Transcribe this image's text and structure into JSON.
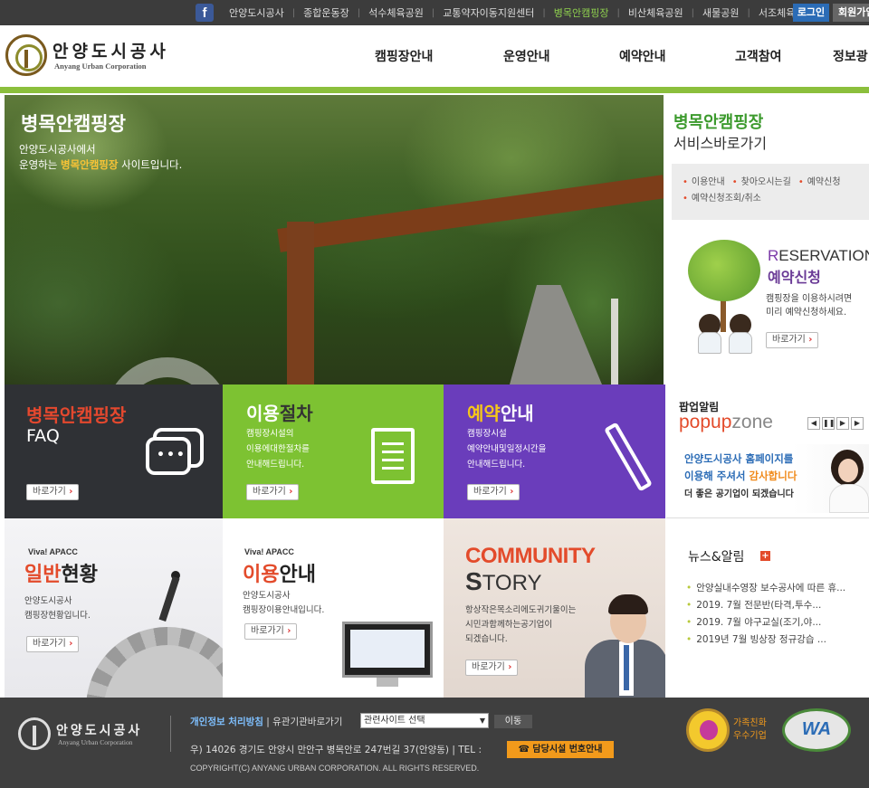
{
  "topbar": {
    "facebook": "f",
    "links": [
      "안양도시공사",
      "종합운동장",
      "석수체육공원",
      "교통약자이동지원센터",
      "병목안캠핑장",
      "비산체육공원",
      "새물공원",
      "서조체육시설"
    ],
    "active_index": 4,
    "login": "로그인",
    "join": "회원가입"
  },
  "header": {
    "logo_ko": "안양도시공사",
    "logo_en": "Anyang Urban Corporation",
    "nav": [
      "캠핑장안내",
      "운영안내",
      "예약안내",
      "고객참여",
      "정보광"
    ]
  },
  "hero": {
    "title": "병목안캠핑장",
    "desc_line1": "안양도시공사에서",
    "desc_pre": "운영하는 ",
    "desc_highlight": "병목안캠핑장",
    "desc_post": " 사이트입니다."
  },
  "service": {
    "title": "병목안캠핑장",
    "subtitle": "서비스바로가기",
    "links": [
      "이용안내",
      "찾아오시는길",
      "예약신청",
      "예약신청조회/취소"
    ],
    "res_en_first": "R",
    "res_en_rest": "ESERVATION",
    "res_ko": "예약신청",
    "res_desc1": "캠핑장을 이용하시려면",
    "res_desc2": "미리 예약신청하세요.",
    "go": "바로가기"
  },
  "tiles": {
    "faq": {
      "title": "병목안캠핑장",
      "sub": "FAQ",
      "go": "바로가기"
    },
    "procedure": {
      "title_a": "이용",
      "title_b": "절차",
      "desc1": "캠핑장시설의",
      "desc2": "이용에대한절차를",
      "desc3": "안내해드립니다.",
      "go": "바로가기"
    },
    "reservation": {
      "title_a": "예약",
      "title_b": "안내",
      "desc1": "캠핑장시설",
      "desc2": "예약안내및일정시간을",
      "desc3": "안내해드립니다.",
      "go": "바로가기"
    },
    "popup": {
      "label": "팝업알림",
      "zone_a": "popup",
      "zone_b": "zone",
      "banner1": "안양도시공사 홈페이지를",
      "banner2_pre": "이용해 주셔서 ",
      "banner2_accent": "감사합니다",
      "banner3": "더 좋은 공기업이 되겠습니다"
    },
    "general": {
      "viva": "Viva! APACC",
      "title_a": "일반",
      "title_b": "현황",
      "desc1": "안양도시공사",
      "desc2": "캠핑장현황입니다.",
      "go": "바로가기"
    },
    "usage": {
      "viva": "Viva! APACC",
      "title_a": "이용",
      "title_b": "안내",
      "desc1": "안양도시공사",
      "desc2": "캠핑장이용안내입니다.",
      "go": "바로가기"
    },
    "community": {
      "line1": "COMMUNITY",
      "line2_big": "S",
      "line2_rest": "TORY",
      "desc1": "항상작은목소리에도귀기울이는",
      "desc2": "시민과함께하는공기업이",
      "desc3": "되겠습니다.",
      "go": "바로가기"
    },
    "news": {
      "title": "뉴스&알림",
      "plus": "+",
      "items": [
        "안양실내수영장 보수공사에 따른 휴...",
        "2019. 7월 전문반(타격,투수...",
        "2019. 7월 야구교실(조기,야...",
        "2019년 7월 빙상장 정규강습 ..."
      ]
    }
  },
  "footer": {
    "logo_ko": "안양도시공사",
    "logo_en": "Anyang Urban Corporation",
    "privacy": "개인정보 처리방침",
    "related": " | 유관기관바로가기",
    "select": "관련사이트 선택",
    "go": "이동",
    "address": "우) 14026 경기도 안양시 만안구 병목안로 247번길 37(안양동) | TEL :",
    "tel_btn": "☎ 담당시설 번호안내",
    "copyright": "COPYRIGHT(C) ANYANG URBAN CORPORATION. ALL RIGHTS RESERVED.",
    "cert1": "가족친화\n우수기업",
    "cert1_l1": "가족친화",
    "cert1_l2": "우수기업",
    "cert2": "WA"
  }
}
